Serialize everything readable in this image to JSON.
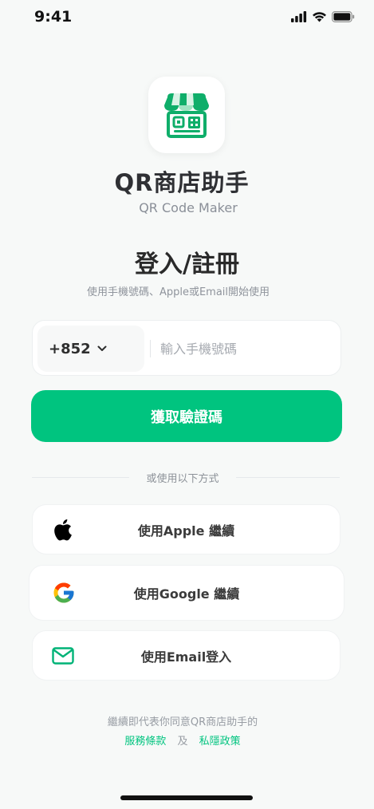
{
  "status_bar": {
    "time": "9:41"
  },
  "app": {
    "name": "QR商店助手",
    "subtitle": "QR Code Maker"
  },
  "auth": {
    "title": "登入/註冊",
    "hint": "使用手機號碼、Apple或Email開始使用"
  },
  "phone": {
    "country_code": "+852",
    "placeholder": "輸入手機號碼",
    "value": ""
  },
  "primary_button": {
    "label": "獲取驗證碼"
  },
  "separator": {
    "label": "或使用以下方式"
  },
  "social": {
    "apple": {
      "label": "使用Apple 繼續",
      "icon": "apple-icon"
    },
    "google": {
      "label": "使用Google 繼續",
      "icon": "google-icon"
    },
    "email": {
      "label": "使用Email登入",
      "icon": "mail-icon"
    }
  },
  "terms": {
    "line1": "繼續即代表你同意QR商店助手的",
    "terms_link": "服務條款",
    "and": "及",
    "privacy_link": "私隱政策"
  },
  "colors": {
    "accent": "#00c47f",
    "background": "#f7f9f8",
    "text_primary": "#2b2b2b",
    "text_muted": "#8f949c"
  }
}
